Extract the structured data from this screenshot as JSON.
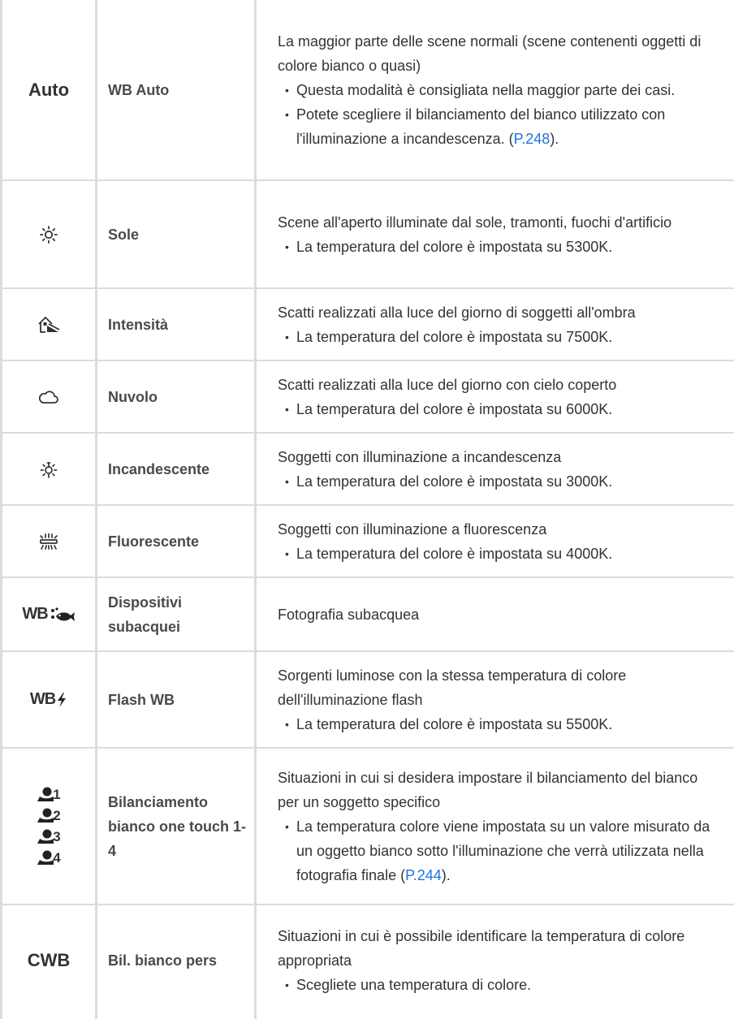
{
  "rows": [
    {
      "icon": "Auto",
      "name": "WB Auto",
      "intro": "La maggior parte delle scene normali (scene contenenti oggetti di colore bianco o quasi)",
      "bullet1": "Questa modalità è consigliata nella maggior parte dei casi.",
      "bullet2": "Potete scegliere il bilanciamento del bianco utilizzato con l'illuminazione a incandescenza. (",
      "link": "P.248",
      "bullet2_end": ")."
    },
    {
      "icon": "sun-icon",
      "name": "Sole",
      "intro": "Scene all'aperto illuminate dal sole, tramonti, fuochi d'artificio",
      "bullet1": "La temperatura del colore è impostata su 5300K."
    },
    {
      "icon": "shade-icon",
      "name": "Intensità",
      "intro": "Scatti realizzati alla luce del giorno di soggetti all'ombra",
      "bullet1": "La temperatura del colore è impostata su 7500K."
    },
    {
      "icon": "cloud-icon",
      "name": "Nuvolo",
      "intro": "Scatti realizzati alla luce del giorno con cielo coperto",
      "bullet1": "La temperatura del colore è impostata su 6000K."
    },
    {
      "icon": "incandescent-bulb-icon",
      "name": "Incandescente",
      "intro": "Soggetti con illuminazione a incandescenza",
      "bullet1": "La temperatura del colore è impostata su 3000K."
    },
    {
      "icon": "fluorescent-icon",
      "name": "Fluorescente",
      "intro": "Soggetti con illuminazione a fluorescenza",
      "bullet1": "La temperatura del colore è impostata su 4000K."
    },
    {
      "icon": "wb-underwater-icon",
      "icon_label": "WB",
      "name": "Dispositivi subacquei",
      "intro": "Fotografia subacquea"
    },
    {
      "icon": "wb-flash-icon",
      "icon_label": "WB",
      "name": "Flash WB",
      "intro": "Sorgenti luminose con la stessa temperatura di colore dell'illuminazione flash",
      "bullet1": "La temperatura del colore è impostata su 5500K."
    },
    {
      "icon": "one-touch-wb-icon",
      "icon_subs": [
        "1",
        "2",
        "3",
        "4"
      ],
      "name": "Bilanciamento bianco one touch 1-4",
      "intro": "Situazioni in cui si desidera impostare il bilanciamento del bianco per un soggetto specifico",
      "bullet1": "La temperatura colore viene impostata su un valore misurato da un oggetto bianco sotto l'illuminazione che verrà utilizzata nella fotografia finale (",
      "link": "P.244",
      "bullet1_end": ")."
    },
    {
      "icon": "CWB",
      "name": "Bil. bianco pers",
      "intro": "Situazioni in cui è possibile identificare la temperatura di colore appropriata",
      "bullet1": "Scegliete una temperatura di colore."
    }
  ],
  "colors": {
    "border": "#dcdcdc",
    "text": "#333333",
    "link": "#1a73e8"
  }
}
